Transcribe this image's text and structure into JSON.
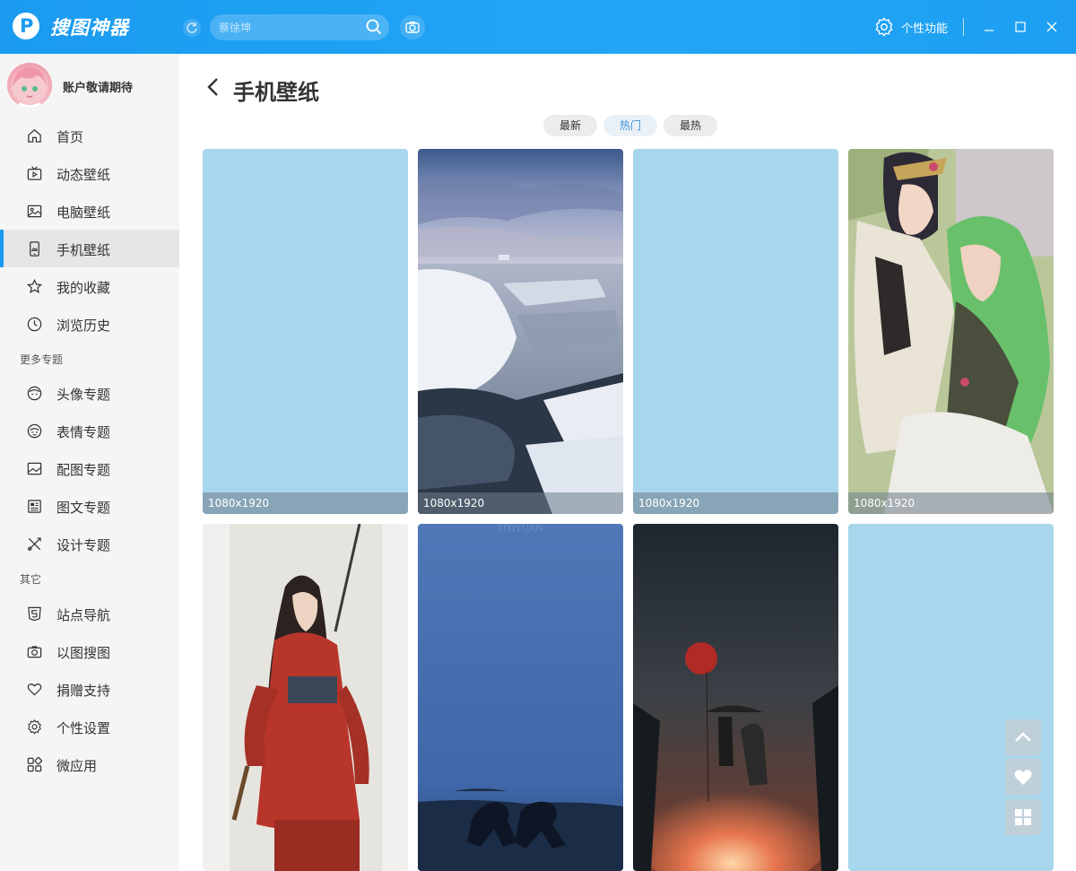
{
  "app": {
    "title": "搜图神器"
  },
  "search": {
    "placeholder": "蔡徐坤"
  },
  "header": {
    "feature_label": "个性功能"
  },
  "user": {
    "name": "账户敬请期待"
  },
  "sidebar": {
    "items": [
      {
        "label": "首页",
        "icon": "home-icon"
      },
      {
        "label": "动态壁纸",
        "icon": "video-icon"
      },
      {
        "label": "电脑壁纸",
        "icon": "image-icon"
      },
      {
        "label": "手机壁纸",
        "icon": "phone-icon",
        "active": true
      },
      {
        "label": "我的收藏",
        "icon": "star-icon"
      },
      {
        "label": "浏览历史",
        "icon": "clock-icon"
      }
    ],
    "section_more": "更多专题",
    "more_items": [
      {
        "label": "头像专题",
        "icon": "face-icon"
      },
      {
        "label": "表情专题",
        "icon": "emoji-icon"
      },
      {
        "label": "配图专题",
        "icon": "picture-icon"
      },
      {
        "label": "图文专题",
        "icon": "article-icon"
      },
      {
        "label": "设计专题",
        "icon": "design-icon"
      }
    ],
    "section_other": "其它",
    "other_items": [
      {
        "label": "站点导航",
        "icon": "html5-icon"
      },
      {
        "label": "以图搜图",
        "icon": "camera-icon"
      },
      {
        "label": "捐赠支持",
        "icon": "heart-icon"
      },
      {
        "label": "个性设置",
        "icon": "gear-icon"
      },
      {
        "label": "微应用",
        "icon": "apps-icon"
      }
    ]
  },
  "main": {
    "title": "手机壁纸",
    "tabs": [
      {
        "label": "最新"
      },
      {
        "label": "热门",
        "active": true
      },
      {
        "label": "最热"
      }
    ],
    "grid": [
      {
        "resolution": "1080x1920",
        "image": "placeholder"
      },
      {
        "resolution": "1080x1920",
        "image": "ice-sea"
      },
      {
        "resolution": "1080x1920",
        "image": "placeholder"
      },
      {
        "resolution": "1080x1920",
        "image": "anime-couple"
      },
      {
        "resolution": "",
        "image": "warrior-girl"
      },
      {
        "resolution": "",
        "image": "blue-sky-runners",
        "watermark": "YIYIYUAN"
      },
      {
        "resolution": "",
        "image": "rain-umbrella"
      },
      {
        "resolution": "",
        "image": "placeholder"
      }
    ]
  },
  "colors": {
    "accent": "#1a9bf0",
    "placeholder": "#a8d6ec"
  }
}
